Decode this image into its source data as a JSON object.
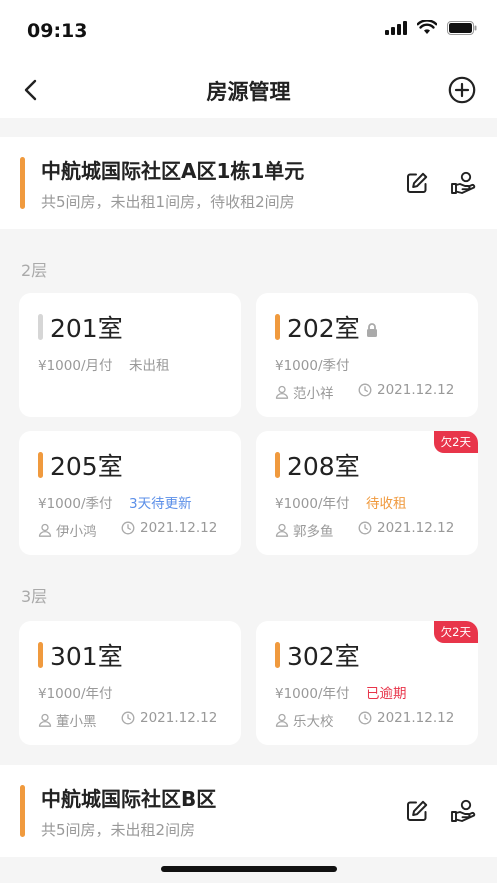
{
  "status": {
    "time": "09:13"
  },
  "nav": {
    "title": "房源管理"
  },
  "buildings": [
    {
      "name": "中航城国际社区A区1栋1单元",
      "summary": "共5间房，未出租1间房，待收租2间房"
    },
    {
      "name": "中航城国际社区B区",
      "summary": "共5间房，未出租2间房"
    }
  ],
  "floors": [
    {
      "label": "2层",
      "rooms": [
        {
          "number": "201室",
          "price": "¥1000/月付",
          "status": "未出租",
          "tenant": "",
          "date": "",
          "overdue": ""
        },
        {
          "number": "202室",
          "price": "¥1000/季付",
          "status": "",
          "tenant": "范小祥",
          "date": "2021.12.12",
          "overdue": ""
        },
        {
          "number": "205室",
          "price": "¥1000/季付",
          "status": "3天待更新",
          "tenant": "伊小鸿",
          "date": "2021.12.12",
          "overdue": ""
        },
        {
          "number": "208室",
          "price": "¥1000/年付",
          "status": "待收租",
          "tenant": "郭多鱼",
          "date": "2021.12.12",
          "overdue": "欠2天"
        }
      ]
    },
    {
      "label": "3层",
      "rooms": [
        {
          "number": "301室",
          "price": "¥1000/年付",
          "status": "",
          "tenant": "董小黑",
          "date": "2021.12.12",
          "overdue": ""
        },
        {
          "number": "302室",
          "price": "¥1000/年付",
          "status": "已逾期",
          "tenant": "乐大校",
          "date": "2021.12.12",
          "overdue": "欠2天"
        }
      ]
    }
  ],
  "colors": {
    "accent": "#f09a3e",
    "vacant": "#d6d6d6",
    "info": "#5b8fe8",
    "danger": "#e8354a",
    "muted": "#999999"
  }
}
